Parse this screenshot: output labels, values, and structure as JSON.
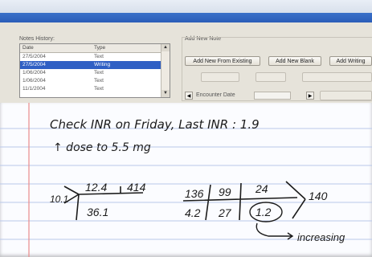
{
  "notes_history": {
    "label": "Notes History:",
    "columns": [
      "Date",
      "Type"
    ],
    "rows": [
      {
        "date": "27/5/2004",
        "type": "Text",
        "selected": false
      },
      {
        "date": "27/5/2004",
        "type": "Writing",
        "selected": true
      },
      {
        "date": "1/06/2004",
        "type": "Text",
        "selected": false
      },
      {
        "date": "1/06/2004",
        "type": "Text",
        "selected": false
      },
      {
        "date": "11/1/2004",
        "type": "Text",
        "selected": false
      }
    ]
  },
  "add_new_note": {
    "label": "Add New Note",
    "from_existing": "Add New From Existing",
    "new_blank": "Add New Blank",
    "add_writing": "Add Writing",
    "encounter_label": "Encounter Date"
  },
  "handwriting": {
    "line1": "Check INR on Friday, Last INR : 1.9",
    "line2": "↑ dose to 5.5 mg",
    "fishbone_left": {
      "left": "10.1",
      "top_left": "12.4",
      "top_right": "414",
      "bottom": "36.1"
    },
    "chem7": {
      "top": [
        "136",
        "99",
        "24"
      ],
      "bottom": [
        "4.2",
        "27",
        "1.2"
      ],
      "right": "140"
    },
    "annotation": "increasing"
  },
  "colors": {
    "selection": "#2f5fc4",
    "rule_line": "#b9c7ea",
    "margin_line": "#e98b8b"
  }
}
